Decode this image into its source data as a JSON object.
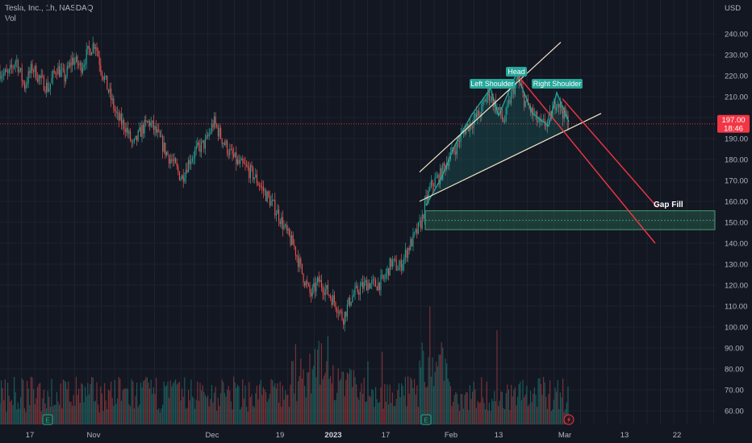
{
  "header": {
    "symbol_line": "Tesla, Inc., 1h, NASDAQ",
    "indicator": "Vol",
    "currency": "USD"
  },
  "price_badge": {
    "price": "197.00",
    "countdown": "18:46"
  },
  "colors": {
    "up": "#26a69a",
    "down": "#ef5350",
    "trendline": "#f0e4c8",
    "target": "#f23645",
    "zone": "#2e7d5b",
    "bg": "#131722"
  },
  "chart_data": {
    "type": "candlestick",
    "y_ticks": [
      60,
      70,
      80,
      90,
      100,
      110,
      120,
      130,
      140,
      150,
      160,
      170,
      180,
      190,
      200,
      210,
      220,
      230,
      240
    ],
    "y_tick_labels": [
      "60.00",
      "70.00",
      "80.00",
      "90.00",
      "100.00",
      "110.00",
      "120.00",
      "130.00",
      "140.00",
      "150.00",
      "160.00",
      "170.00",
      "180.00",
      "190.00",
      "200.00",
      "210.00",
      "220.00",
      "230.00",
      "240.00"
    ],
    "ylim": [
      54,
      250
    ],
    "x_ticks": [
      {
        "label": "17",
        "bold": false
      },
      {
        "label": "Nov",
        "bold": false
      },
      {
        "label": "Dec",
        "bold": false
      },
      {
        "label": "19",
        "bold": false
      },
      {
        "label": "2023",
        "bold": true
      },
      {
        "label": "17",
        "bold": false
      },
      {
        "label": "Feb",
        "bold": false
      },
      {
        "label": "13",
        "bold": false
      },
      {
        "label": "Mar",
        "bold": false
      },
      {
        "label": "13",
        "bold": false
      },
      {
        "label": "22",
        "bold": false
      }
    ],
    "price_path": [
      [
        0,
        222
      ],
      [
        10,
        220
      ],
      [
        20,
        228
      ],
      [
        30,
        215
      ],
      [
        40,
        224
      ],
      [
        50,
        218
      ],
      [
        60,
        214
      ],
      [
        70,
        224
      ],
      [
        80,
        219
      ],
      [
        90,
        228
      ],
      [
        100,
        224
      ],
      [
        110,
        232
      ],
      [
        118,
        236
      ],
      [
        125,
        224
      ],
      [
        135,
        212
      ],
      [
        145,
        200
      ],
      [
        155,
        196
      ],
      [
        165,
        186
      ],
      [
        175,
        194
      ],
      [
        185,
        198
      ],
      [
        195,
        192
      ],
      [
        205,
        184
      ],
      [
        215,
        178
      ],
      [
        225,
        171
      ],
      [
        235,
        180
      ],
      [
        245,
        185
      ],
      [
        255,
        188
      ],
      [
        265,
        198
      ],
      [
        275,
        190
      ],
      [
        285,
        183
      ],
      [
        295,
        178
      ],
      [
        305,
        176
      ],
      [
        315,
        172
      ],
      [
        325,
        166
      ],
      [
        335,
        160
      ],
      [
        345,
        154
      ],
      [
        355,
        145
      ],
      [
        365,
        138
      ],
      [
        375,
        125
      ],
      [
        385,
        115
      ],
      [
        395,
        122
      ],
      [
        405,
        117
      ],
      [
        415,
        112
      ],
      [
        425,
        104
      ],
      [
        435,
        114
      ],
      [
        445,
        118
      ],
      [
        455,
        121
      ],
      [
        465,
        120
      ],
      [
        475,
        122
      ],
      [
        485,
        131
      ],
      [
        495,
        128
      ],
      [
        505,
        137
      ],
      [
        515,
        144
      ],
      [
        522,
        150
      ],
      [
        528,
        160
      ],
      [
        535,
        168
      ],
      [
        545,
        172
      ],
      [
        555,
        180
      ],
      [
        565,
        186
      ],
      [
        575,
        194
      ],
      [
        585,
        198
      ],
      [
        595,
        202
      ],
      [
        605,
        212
      ],
      [
        615,
        205
      ],
      [
        625,
        198
      ],
      [
        635,
        213
      ],
      [
        642,
        218
      ],
      [
        650,
        208
      ],
      [
        660,
        202
      ],
      [
        670,
        196
      ],
      [
        680,
        198
      ],
      [
        690,
        209
      ],
      [
        697,
        203
      ],
      [
        705,
        197
      ]
    ],
    "annotations": {
      "labels": [
        "Left Shoulder",
        "Head",
        "Right Shoulder",
        "Gap Fill"
      ],
      "upper_channel": [
        [
          520,
          174
        ],
        [
          695,
          236
        ]
      ],
      "lower_channel": [
        [
          520,
          160
        ],
        [
          745,
          202
        ]
      ],
      "gap_zone": {
        "x_from": 527,
        "y_low": 146.5,
        "y_high": 155.5
      },
      "targets": [
        {
          "from": [
            697,
            209
          ],
          "to": [
            815,
            157
          ]
        },
        {
          "from": [
            640,
            221
          ],
          "to": [
            812,
            140
          ]
        }
      ],
      "current_price_line": 197
    },
    "events": [
      "E",
      "E",
      "E"
    ]
  }
}
